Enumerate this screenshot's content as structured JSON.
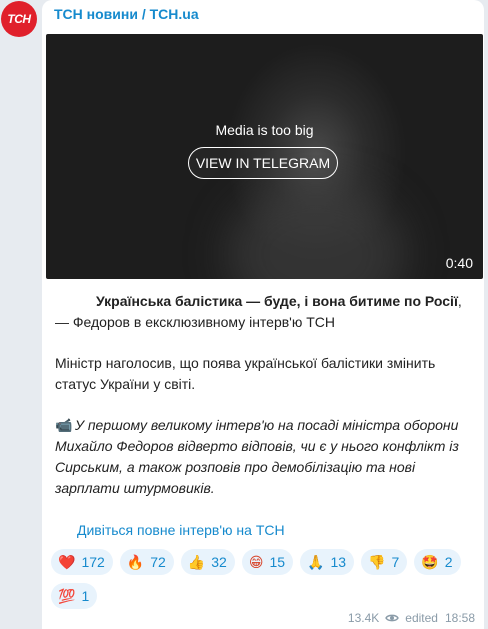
{
  "channel": {
    "name": "ТСН новини / TCH.ua",
    "avatar_text": "ТСН"
  },
  "media": {
    "message": "Media is too big",
    "button_label": "VIEW IN TELEGRAM",
    "duration": "0:40"
  },
  "post": {
    "headline_bold": "Українська балістика — буде, і вона битиме по Росії",
    "headline_rest": ", — Федоров в ексклюзивному інтерв'ю ТСН",
    "paragraph2": "Міністр наголосив, що поява української балістики змінить статус України у світі.",
    "camera_emoji": "📹",
    "paragraph3": "У першому великому інтерв'ю на посаді міністра оборони Михайло Федоров відверто відповів, чи є у нього конфлікт із Сирським, а також розповів про демобілізацію та нові зарплати штурмовиків.",
    "link_text": "Дивіться повне інтерв'ю на ТСН"
  },
  "reactions": [
    {
      "emoji": "❤️",
      "count": "172"
    },
    {
      "emoji": "🔥",
      "count": "72"
    },
    {
      "emoji": "👍",
      "count": "32"
    },
    {
      "emoji": "😁",
      "count": "15"
    },
    {
      "emoji": "🙏",
      "count": "13"
    },
    {
      "emoji": "👎",
      "count": "7"
    },
    {
      "emoji": "🤩",
      "count": "2"
    },
    {
      "emoji": "💯",
      "count": "1"
    }
  ],
  "meta": {
    "views": "13.4K",
    "edited": "edited",
    "time": "18:58"
  },
  "colors": {
    "accent": "#168acd",
    "avatar_bg": "#e0202b",
    "reaction_bg": "#e8f3fc"
  }
}
